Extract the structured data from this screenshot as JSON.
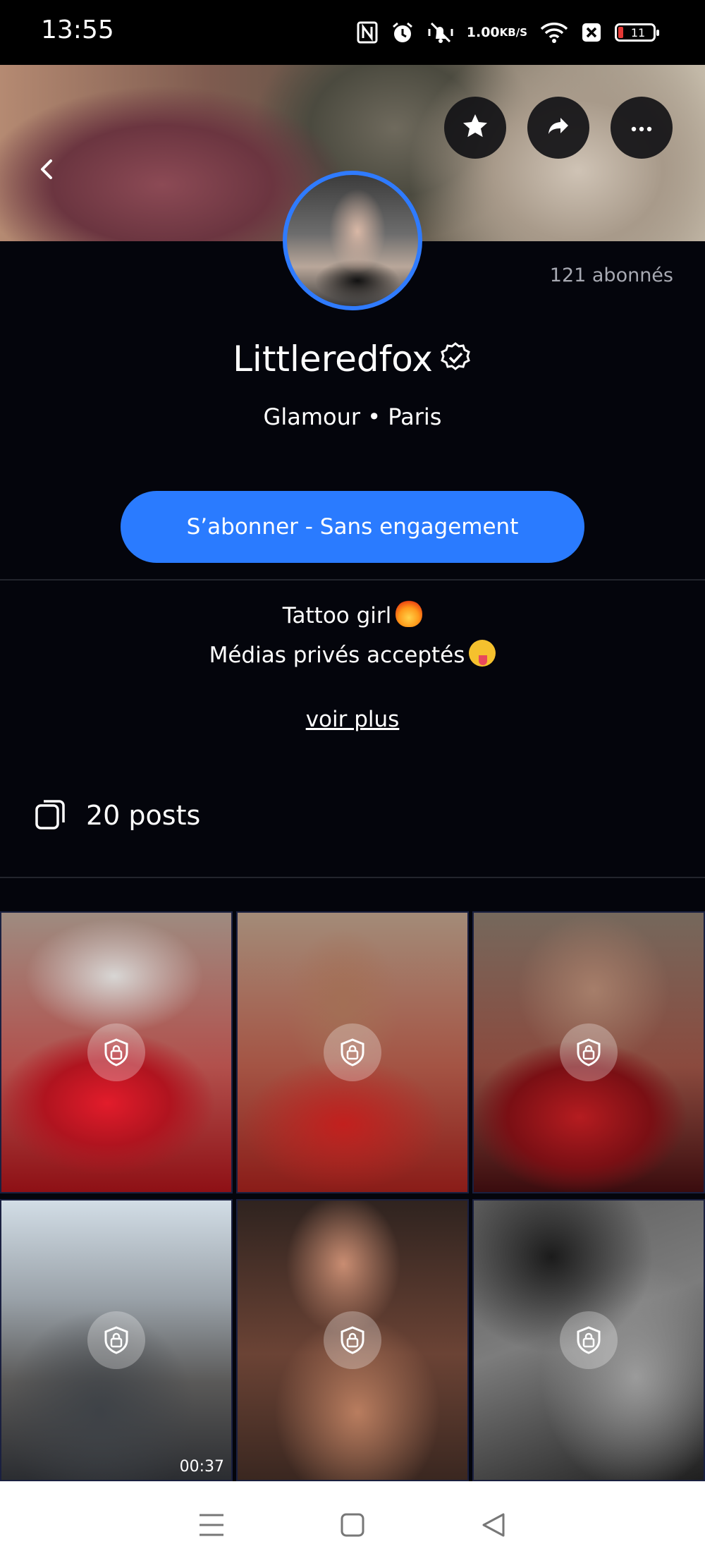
{
  "status_bar": {
    "time": "13:55",
    "net_speed_value": "1.00",
    "net_speed_unit": "KB/S",
    "battery_level": "11",
    "battery_color": "#e53935",
    "icons": [
      "nfc-icon",
      "alarm-icon",
      "vibrate-off-icon",
      "wifi-icon",
      "sim-off-icon",
      "battery-icon"
    ]
  },
  "header": {
    "icons": [
      "back-chevron-icon",
      "star-icon",
      "share-icon",
      "more-icon"
    ]
  },
  "profile": {
    "name": "Littleredfox",
    "verified_icon": "verified-badge-icon",
    "subtitle": "Glamour • Paris",
    "followers": "121 abonnés",
    "accent_color": "#2a7bff"
  },
  "subscribe": {
    "label": "S’abonner - Sans engagement"
  },
  "bio": {
    "line1": "Tattoo girl",
    "line1_emoji": "fire-emoji",
    "line2": "Médias privés acceptés",
    "line2_emoji": "winking-tongue-emoji",
    "see_more": "voir plus"
  },
  "posts": {
    "icon": "posts-stack-icon",
    "count_label": "20 posts",
    "items": [
      {
        "locked": true,
        "duration": ""
      },
      {
        "locked": true,
        "duration": ""
      },
      {
        "locked": true,
        "duration": ""
      },
      {
        "locked": true,
        "duration": "00:37"
      },
      {
        "locked": true,
        "duration": ""
      },
      {
        "locked": true,
        "duration": ""
      }
    ]
  },
  "nav_bar": {
    "icons": [
      "menu-icon",
      "home-square-icon",
      "back-triangle-icon"
    ]
  }
}
